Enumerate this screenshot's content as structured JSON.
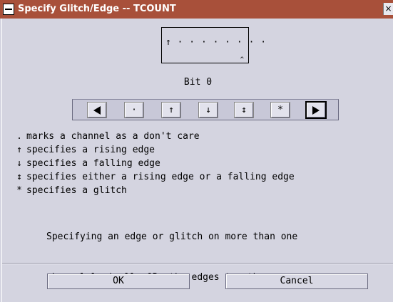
{
  "window": {
    "title": "Specify Glitch/Edge -- TCOUNT",
    "close_glyph": "×"
  },
  "bit_display": {
    "pattern": "↑ · · · · · · · ·",
    "marker": "^",
    "label": "Bit 0"
  },
  "edge_buttons": [
    {
      "name": "previous-bit",
      "glyph": ""
    },
    {
      "name": "dont-care",
      "glyph": "·"
    },
    {
      "name": "rising-edge",
      "glyph": "↑"
    },
    {
      "name": "falling-edge",
      "glyph": "↓"
    },
    {
      "name": "either-edge",
      "glyph": "↕"
    },
    {
      "name": "glitch",
      "glyph": "*"
    },
    {
      "name": "next-bit",
      "glyph": ""
    }
  ],
  "legend": [
    {
      "symbol": ".",
      "text": "marks a channel as a don't care"
    },
    {
      "symbol": "↑",
      "text": "specifies a rising edge"
    },
    {
      "symbol": "↓",
      "text": "specifies a falling edge"
    },
    {
      "symbol": "↕",
      "text": "specifies either a rising edge or a falling edge"
    },
    {
      "symbol": "*",
      "text": "specifies a glitch"
    }
  ],
  "note": {
    "line1": "Specifying an edge or glitch on more than one",
    "line2": "channel logically ORs the edges together."
  },
  "buttons": {
    "ok_label": "OK",
    "cancel_label": "Cancel"
  },
  "colors": {
    "titlebar": "#a8503a",
    "background": "#d4d4e0"
  }
}
